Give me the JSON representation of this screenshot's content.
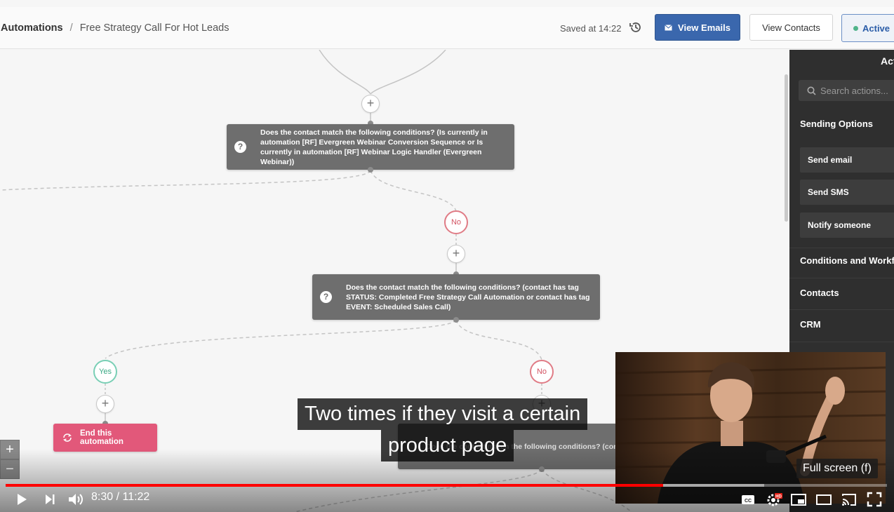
{
  "header": {
    "breadcrumb_root": "Automations",
    "breadcrumb_sep": "/",
    "breadcrumb_current": "Free Strategy Call For Hot Leads",
    "saved_text": "Saved at 14:22",
    "view_emails_label": "View Emails",
    "view_contacts_label": "View Contacts",
    "status_label": "Active"
  },
  "workflow": {
    "condition1_text": "Does the contact match the following conditions? (Is currently in automation [RF] Evergreen Webinar Conversion Sequence or Is currently in automation [RF] Webinar Logic Handler (Evergreen Webinar))",
    "condition2_text": "Does the contact match the following conditions? (contact has tag STATUS: Completed Free Strategy Call Automation or contact has tag EVENT: Scheduled Sales Call)",
    "condition3_text": "Does the contact match the following conditions? (contact ... funnel or contact has tag PURC...",
    "no_label": "No",
    "yes_label": "Yes",
    "end_label": "End this automation",
    "plus_symbol": "+",
    "zoom_in": "+",
    "zoom_out": "−"
  },
  "actions_panel": {
    "title": "Actions",
    "search_placeholder": "Search actions...",
    "sections": [
      "Sending Options",
      "Conditions and Workflow",
      "Contacts",
      "CRM"
    ],
    "sending_items": [
      "Send email",
      "Send SMS",
      "Notify someone"
    ]
  },
  "video": {
    "subtitle_line1": "Two times if they visit a certain",
    "subtitle_line2": "product page",
    "tooltip": "Full screen (f)",
    "time_display": "8:30 / 11:22",
    "played_fraction": 0.7457,
    "buffered_fraction": 0.861
  },
  "colors": {
    "primary_blue": "#3a67ad",
    "no_red": "#d35362",
    "yes_green": "#3aa984",
    "end_pink": "#e2587a",
    "panel_dark": "#2f2f2f",
    "progress_red": "#ff0000"
  }
}
